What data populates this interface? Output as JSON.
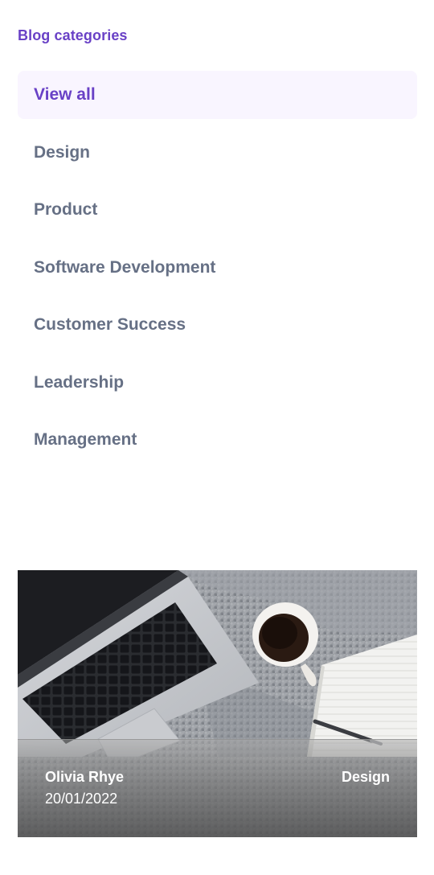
{
  "sidebar": {
    "heading": "Blog categories",
    "items": [
      {
        "label": "View all",
        "active": true
      },
      {
        "label": "Design",
        "active": false
      },
      {
        "label": "Product",
        "active": false
      },
      {
        "label": "Software Development",
        "active": false
      },
      {
        "label": "Customer Success",
        "active": false
      },
      {
        "label": "Leadership",
        "active": false
      },
      {
        "label": "Management",
        "active": false
      }
    ]
  },
  "featured_post": {
    "image_icon": "laptop-coffee-photo",
    "author": "Olivia Rhye",
    "date": "20/01/2022",
    "category": "Design"
  },
  "colors": {
    "accent": "#6941c6",
    "active_bg": "#f9f5ff",
    "muted_text": "#667085"
  }
}
